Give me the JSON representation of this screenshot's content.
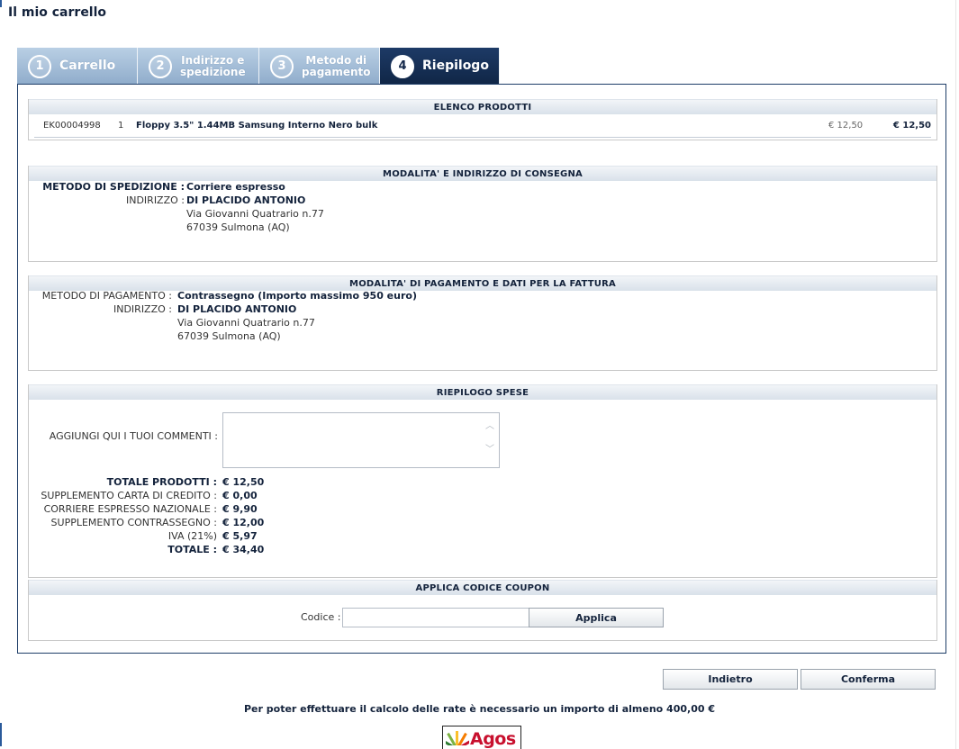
{
  "page_title": "Il mio carrello",
  "steps": [
    {
      "num": "1",
      "label": "Carrello",
      "active": false
    },
    {
      "num": "2",
      "label_line1": "Indirizzo e",
      "label_line2": "spedizione",
      "active": false
    },
    {
      "num": "3",
      "label_line1": "Metodo di",
      "label_line2": "pagamento",
      "active": false
    },
    {
      "num": "4",
      "label": "Riepilogo",
      "active": true
    }
  ],
  "products_section": {
    "title": "ELENCO PRODOTTI",
    "items": [
      {
        "code": "EK00004998",
        "qty": "1",
        "name": "Floppy 3.5\" 1.44MB Samsung Interno Nero bulk",
        "unit_price": "€ 12,50",
        "total": "€ 12,50"
      }
    ]
  },
  "delivery_section": {
    "title": "MODALITA' E INDIRIZZO DI CONSEGNA",
    "method_label": "METODO DI SPEDIZIONE :",
    "method_value": "Corriere espresso",
    "address_label": "INDIRIZZO :",
    "address_name": "DI PLACIDO ANTONIO",
    "address_line1": "Via Giovanni Quatrario n.77",
    "address_line2": "67039 Sulmona (AQ)"
  },
  "payment_section": {
    "title": "MODALITA' DI PAGAMENTO E DATI PER LA FATTURA",
    "method_label": "METODO DI PAGAMENTO :",
    "method_value": "Contrassegno (Importo massimo 950 euro)",
    "address_label": "INDIRIZZO :",
    "address_name": "DI PLACIDO ANTONIO",
    "address_line1": "Via Giovanni Quatrario n.77",
    "address_line2": "67039 Sulmona (AQ)"
  },
  "summary_section": {
    "title": "RIEPILOGO SPESE",
    "comment_label": "AGGIUNGI QUI I TUOI COMMENTI :",
    "comment_value": "",
    "rows": [
      {
        "label": "TOTALE PRODOTTI :",
        "value": "€ 12,50",
        "bold_label": true
      },
      {
        "label": "SUPPLEMENTO CARTA DI CREDITO :",
        "value": "€ 0,00",
        "bold_label": false
      },
      {
        "label": "CORRIERE ESPRESSO NAZIONALE :",
        "value": "€ 9,90",
        "bold_label": false
      },
      {
        "label": "SUPPLEMENTO CONTRASSEGNO :",
        "value": "€ 12,00",
        "bold_label": false
      },
      {
        "label": "IVA (21%)",
        "value": "€ 5,97",
        "bold_label": false
      },
      {
        "label": "TOTALE :",
        "value": "€ 34,40",
        "bold_label": true
      }
    ]
  },
  "coupon_section": {
    "title": "APPLICA CODICE COUPON",
    "code_label": "Codice :",
    "code_value": "",
    "apply_label": "Applica"
  },
  "actions": {
    "back_label": "Indietro",
    "confirm_label": "Conferma"
  },
  "installment_info": "Per poter effettuare il calcolo delle rate è necessario un importo di almeno 400,00 €",
  "partner_logo": {
    "text": "Agos",
    "color": "#c8102e"
  }
}
